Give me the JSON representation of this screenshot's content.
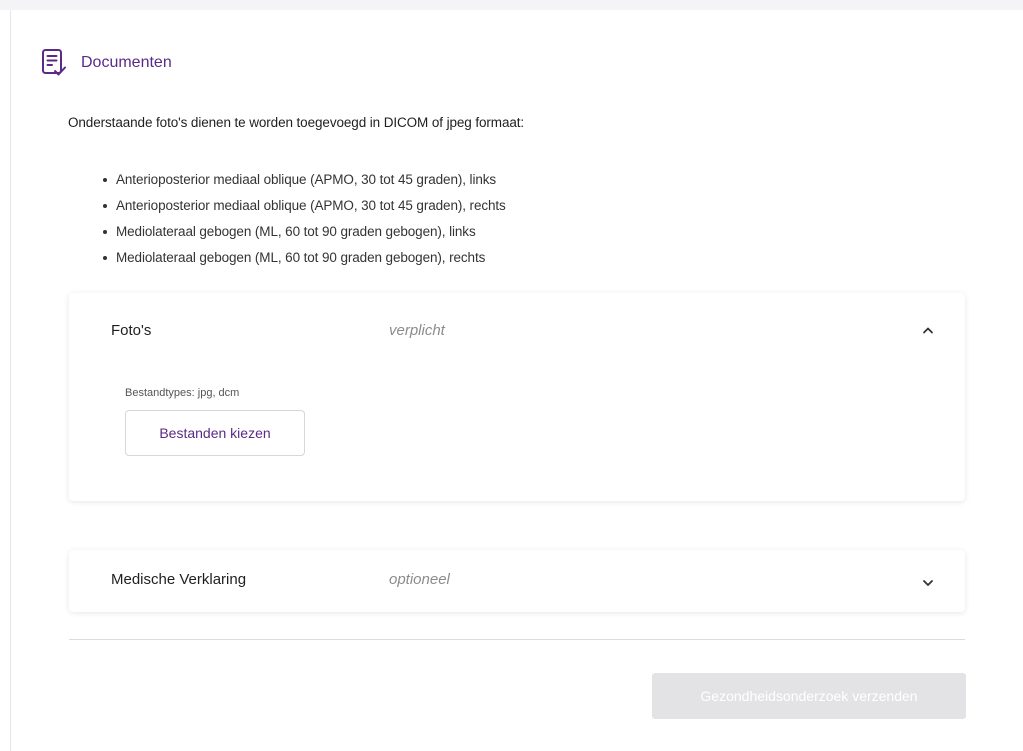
{
  "section": {
    "title": "Documenten",
    "icon": "document-check-icon"
  },
  "intro_text": "Onderstaande foto's dienen te worden toegevoegd in DICOM of jpeg formaat:",
  "photo_requirements": [
    "Anterioposterior mediaal oblique (APMO, 30 tot 45 graden), links",
    "Anterioposterior mediaal oblique (APMO, 30 tot 45 graden), rechts",
    "Mediolateraal gebogen (ML, 60 tot 90 graden gebogen), links",
    "Mediolateraal gebogen (ML, 60 tot 90 graden gebogen), rechts"
  ],
  "cards": {
    "photos": {
      "title": "Foto's",
      "status": "verplicht",
      "expanded": true,
      "filetypes": "Bestandtypes: jpg, dcm",
      "choose_label": "Bestanden kiezen"
    },
    "medical": {
      "title": "Medische Verklaring",
      "status": "optioneel",
      "expanded": false
    }
  },
  "submit_label": "Gezondheidsonderzoek verzenden",
  "colors": {
    "accent": "#5b2a86",
    "muted": "#8c8c8c",
    "disabled_button": "#e3e3e6"
  }
}
